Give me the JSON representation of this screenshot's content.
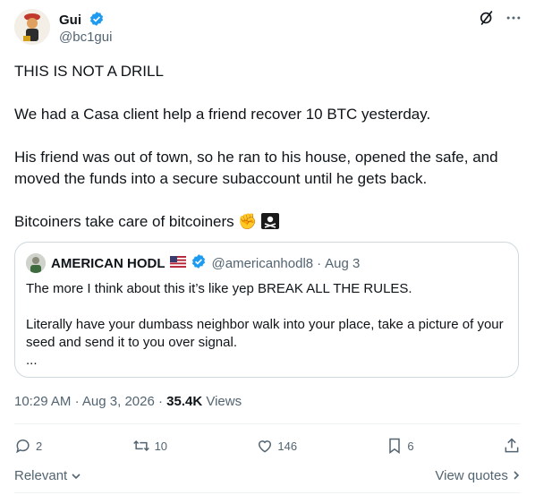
{
  "author": {
    "name": "Gui",
    "handle": "@bc1gui"
  },
  "tweet": {
    "paragraphs": [
      "THIS IS NOT A DRILL",
      "We had a Casa client help a friend recover 10 BTC yesterday.",
      "His friend was out of town, so he ran to his house, opened the safe, and moved the funds into a secure subaccount until he gets back.",
      "Bitcoiners take care of bitcoiners"
    ],
    "emojis": [
      "✊",
      "☠"
    ]
  },
  "quote": {
    "name": "AMERICAN HODL",
    "flag": "🇺🇸",
    "handle": "@americanhodl8",
    "date": "Aug 3",
    "line1": "The more I think about this it’s like yep BREAK ALL THE RULES.",
    "line2": "Literally have your dumbass neighbor walk into your place, take a picture of your seed and send it to you over signal.",
    "ellipsis": "..."
  },
  "meta": {
    "time": "10:29 AM",
    "date": "Aug 3, 2026",
    "views_count": "35.4K",
    "views_label": "Views"
  },
  "actions": {
    "replies": "2",
    "reposts": "10",
    "likes": "146",
    "bookmarks": "6"
  },
  "footer": {
    "relevant": "Relevant",
    "view_quotes": "View quotes"
  },
  "colors": {
    "verified": "#1d9bf0",
    "secondary_text": "#536471",
    "border": "#cfd9de"
  }
}
